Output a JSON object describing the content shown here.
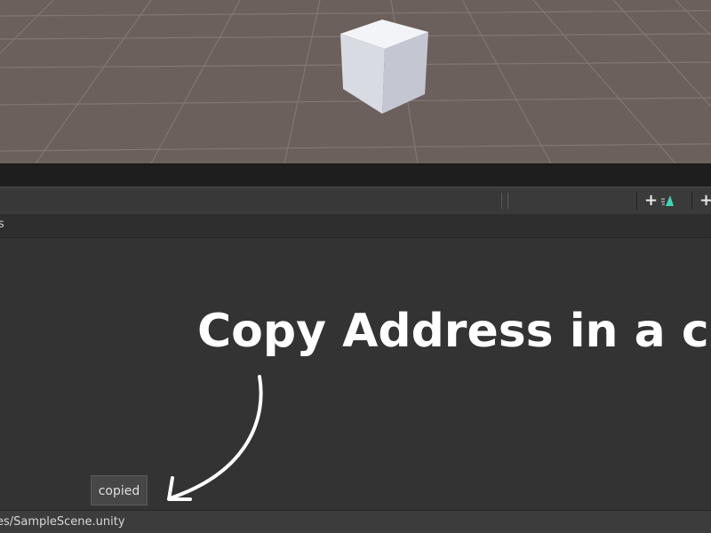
{
  "scene": {
    "object_icon": "cube-icon",
    "background_color": "#6b605c"
  },
  "toolbar": {
    "add_button_1": {
      "label": "+",
      "icon": "teal-arrow-icon"
    },
    "add_button_2": {
      "label": "+"
    }
  },
  "tab": {
    "label": "s"
  },
  "overlay": {
    "headline": "Copy Address in a cli",
    "badge": "copied",
    "arrow_icon": "curved-arrow-icon"
  },
  "status_bar": {
    "path": "es/SampleScene.unity"
  }
}
